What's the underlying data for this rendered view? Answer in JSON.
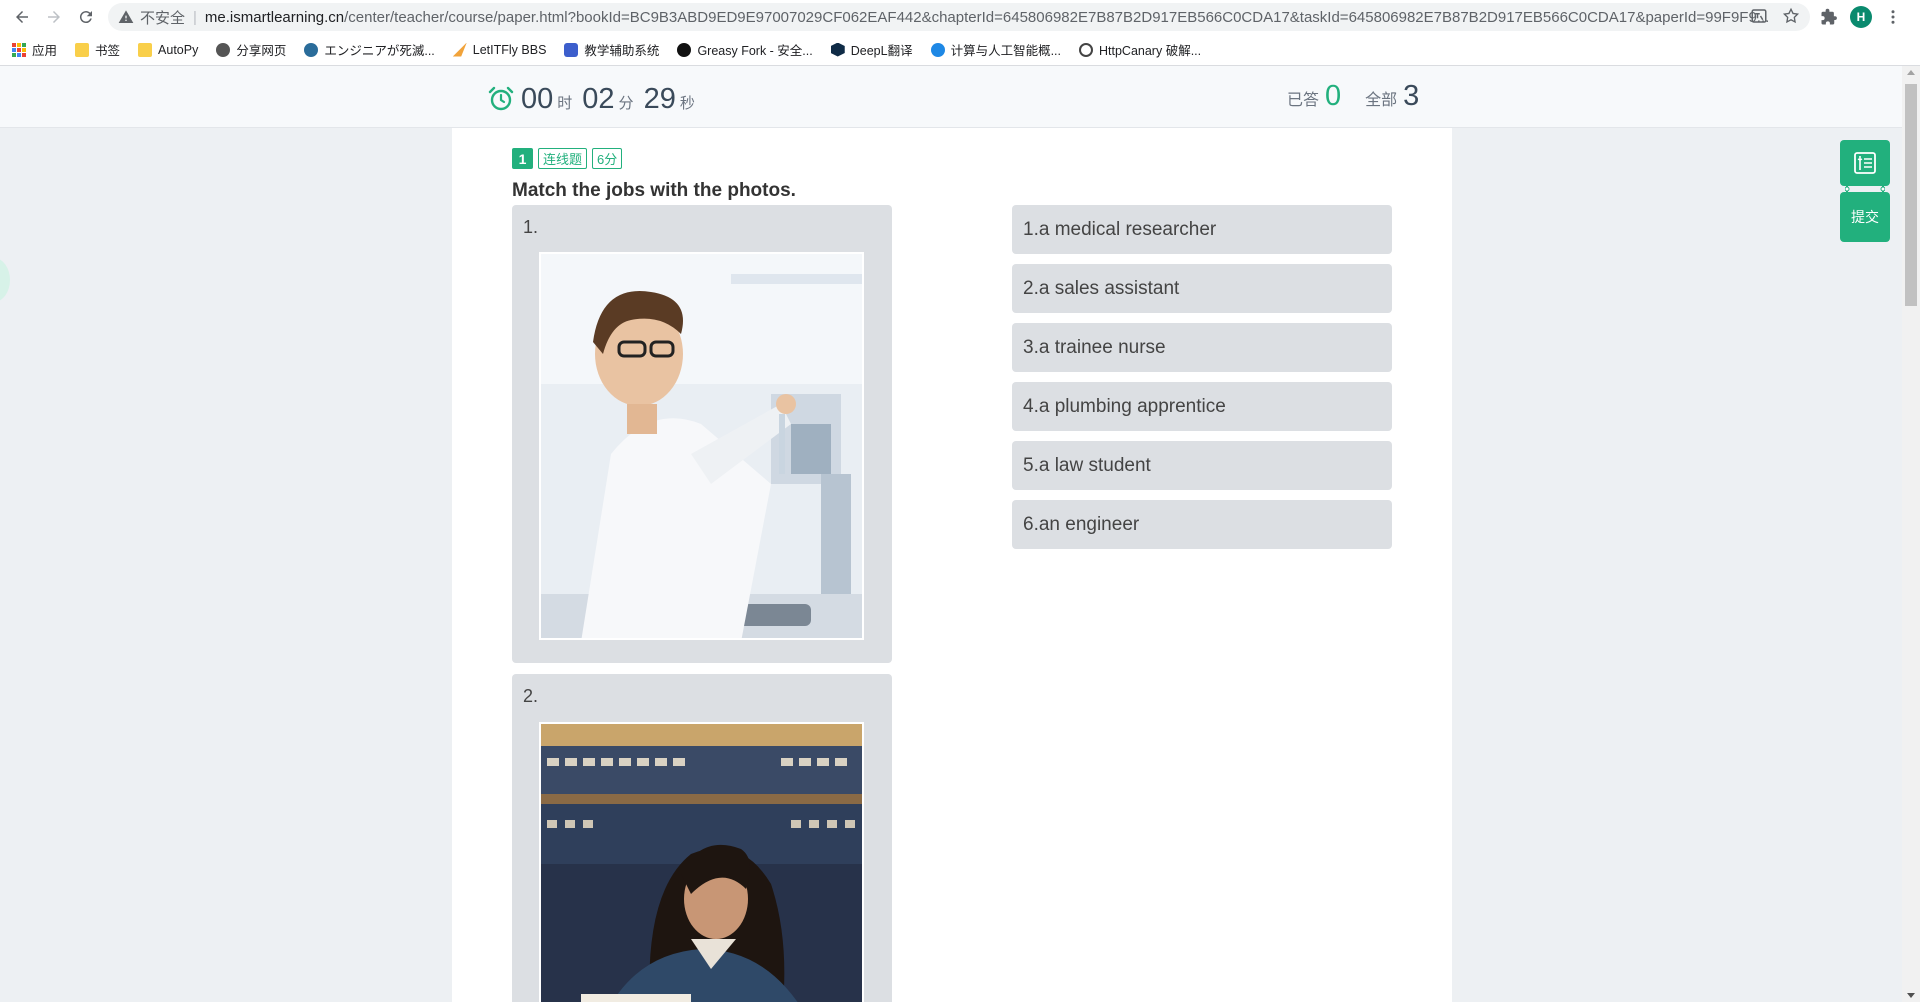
{
  "browser": {
    "insecure_label": "不安全",
    "url_host": "me.ismartlearning.cn",
    "url_path": "/center/teacher/course/paper.html?bookId=BC9B3ABD9ED9E97007029CF062EAF442&chapterId=645806982E7B87B2D917EB566C0CDA17&taskId=645806982E7B87B2D917EB566C0CDA17&paperId=99F9F9...",
    "avatar_letter": "H"
  },
  "bookmarks": [
    {
      "label": "应用",
      "icon": "apps-grid-icon"
    },
    {
      "label": "书签",
      "icon": "folder-icon"
    },
    {
      "label": "AutoPy",
      "icon": "folder-icon"
    },
    {
      "label": "分享网页",
      "icon": "globe-icon"
    },
    {
      "label": "エンジニアが死滅...",
      "icon": "site-icon"
    },
    {
      "label": "LetITFly BBS",
      "icon": "site-icon"
    },
    {
      "label": "教学辅助系统",
      "icon": "site-icon"
    },
    {
      "label": "Greasy Fork - 安全...",
      "icon": "site-icon"
    },
    {
      "label": "DeepL翻译",
      "icon": "site-icon"
    },
    {
      "label": "计算与人工智能概...",
      "icon": "site-icon"
    },
    {
      "label": "HttpCanary 破解...",
      "icon": "site-icon"
    }
  ],
  "timer": {
    "hours": "00",
    "hours_unit": "时",
    "minutes": "02",
    "minutes_unit": "分",
    "seconds": "29",
    "seconds_unit": "秒"
  },
  "progress": {
    "answered_label": "已答",
    "answered": "0",
    "total_label": "全部",
    "total": "3"
  },
  "question": {
    "number": "1",
    "type": "连线题",
    "score": "6分",
    "title": "Match the jobs with the photos.",
    "photos": [
      {
        "index": "1.",
        "subject": "lab-researcher-photo"
      },
      {
        "index": "2.",
        "subject": "law-student-photo"
      }
    ],
    "options": [
      "1.a medical researcher",
      "2.a sales assistant",
      "3.a trainee nurse",
      "4.a plumbing apprentice",
      "5.a law student",
      "6.an engineer"
    ]
  },
  "side": {
    "submit_label": "提交"
  },
  "colors": {
    "accent": "#22b07d",
    "card_bg": "#dcdfe3",
    "page_bg": "#edf0f3"
  }
}
